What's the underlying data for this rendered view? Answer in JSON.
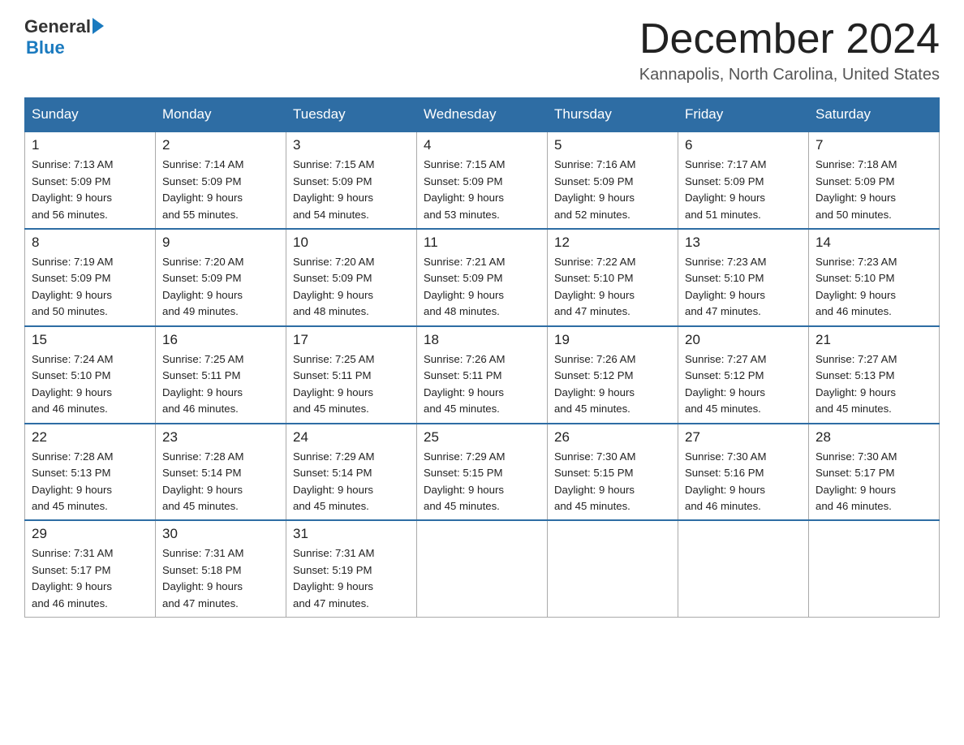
{
  "header": {
    "logo_general": "General",
    "logo_blue": "Blue",
    "month_title": "December 2024",
    "location": "Kannapolis, North Carolina, United States"
  },
  "days_of_week": [
    "Sunday",
    "Monday",
    "Tuesday",
    "Wednesday",
    "Thursday",
    "Friday",
    "Saturday"
  ],
  "weeks": [
    [
      {
        "day": "1",
        "sunrise": "7:13 AM",
        "sunset": "5:09 PM",
        "daylight": "9 hours and 56 minutes."
      },
      {
        "day": "2",
        "sunrise": "7:14 AM",
        "sunset": "5:09 PM",
        "daylight": "9 hours and 55 minutes."
      },
      {
        "day": "3",
        "sunrise": "7:15 AM",
        "sunset": "5:09 PM",
        "daylight": "9 hours and 54 minutes."
      },
      {
        "day": "4",
        "sunrise": "7:15 AM",
        "sunset": "5:09 PM",
        "daylight": "9 hours and 53 minutes."
      },
      {
        "day": "5",
        "sunrise": "7:16 AM",
        "sunset": "5:09 PM",
        "daylight": "9 hours and 52 minutes."
      },
      {
        "day": "6",
        "sunrise": "7:17 AM",
        "sunset": "5:09 PM",
        "daylight": "9 hours and 51 minutes."
      },
      {
        "day": "7",
        "sunrise": "7:18 AM",
        "sunset": "5:09 PM",
        "daylight": "9 hours and 50 minutes."
      }
    ],
    [
      {
        "day": "8",
        "sunrise": "7:19 AM",
        "sunset": "5:09 PM",
        "daylight": "9 hours and 50 minutes."
      },
      {
        "day": "9",
        "sunrise": "7:20 AM",
        "sunset": "5:09 PM",
        "daylight": "9 hours and 49 minutes."
      },
      {
        "day": "10",
        "sunrise": "7:20 AM",
        "sunset": "5:09 PM",
        "daylight": "9 hours and 48 minutes."
      },
      {
        "day": "11",
        "sunrise": "7:21 AM",
        "sunset": "5:09 PM",
        "daylight": "9 hours and 48 minutes."
      },
      {
        "day": "12",
        "sunrise": "7:22 AM",
        "sunset": "5:10 PM",
        "daylight": "9 hours and 47 minutes."
      },
      {
        "day": "13",
        "sunrise": "7:23 AM",
        "sunset": "5:10 PM",
        "daylight": "9 hours and 47 minutes."
      },
      {
        "day": "14",
        "sunrise": "7:23 AM",
        "sunset": "5:10 PM",
        "daylight": "9 hours and 46 minutes."
      }
    ],
    [
      {
        "day": "15",
        "sunrise": "7:24 AM",
        "sunset": "5:10 PM",
        "daylight": "9 hours and 46 minutes."
      },
      {
        "day": "16",
        "sunrise": "7:25 AM",
        "sunset": "5:11 PM",
        "daylight": "9 hours and 46 minutes."
      },
      {
        "day": "17",
        "sunrise": "7:25 AM",
        "sunset": "5:11 PM",
        "daylight": "9 hours and 45 minutes."
      },
      {
        "day": "18",
        "sunrise": "7:26 AM",
        "sunset": "5:11 PM",
        "daylight": "9 hours and 45 minutes."
      },
      {
        "day": "19",
        "sunrise": "7:26 AM",
        "sunset": "5:12 PM",
        "daylight": "9 hours and 45 minutes."
      },
      {
        "day": "20",
        "sunrise": "7:27 AM",
        "sunset": "5:12 PM",
        "daylight": "9 hours and 45 minutes."
      },
      {
        "day": "21",
        "sunrise": "7:27 AM",
        "sunset": "5:13 PM",
        "daylight": "9 hours and 45 minutes."
      }
    ],
    [
      {
        "day": "22",
        "sunrise": "7:28 AM",
        "sunset": "5:13 PM",
        "daylight": "9 hours and 45 minutes."
      },
      {
        "day": "23",
        "sunrise": "7:28 AM",
        "sunset": "5:14 PM",
        "daylight": "9 hours and 45 minutes."
      },
      {
        "day": "24",
        "sunrise": "7:29 AM",
        "sunset": "5:14 PM",
        "daylight": "9 hours and 45 minutes."
      },
      {
        "day": "25",
        "sunrise": "7:29 AM",
        "sunset": "5:15 PM",
        "daylight": "9 hours and 45 minutes."
      },
      {
        "day": "26",
        "sunrise": "7:30 AM",
        "sunset": "5:15 PM",
        "daylight": "9 hours and 45 minutes."
      },
      {
        "day": "27",
        "sunrise": "7:30 AM",
        "sunset": "5:16 PM",
        "daylight": "9 hours and 46 minutes."
      },
      {
        "day": "28",
        "sunrise": "7:30 AM",
        "sunset": "5:17 PM",
        "daylight": "9 hours and 46 minutes."
      }
    ],
    [
      {
        "day": "29",
        "sunrise": "7:31 AM",
        "sunset": "5:17 PM",
        "daylight": "9 hours and 46 minutes."
      },
      {
        "day": "30",
        "sunrise": "7:31 AM",
        "sunset": "5:18 PM",
        "daylight": "9 hours and 47 minutes."
      },
      {
        "day": "31",
        "sunrise": "7:31 AM",
        "sunset": "5:19 PM",
        "daylight": "9 hours and 47 minutes."
      },
      null,
      null,
      null,
      null
    ]
  ],
  "labels": {
    "sunrise": "Sunrise:",
    "sunset": "Sunset:",
    "daylight": "Daylight:"
  }
}
